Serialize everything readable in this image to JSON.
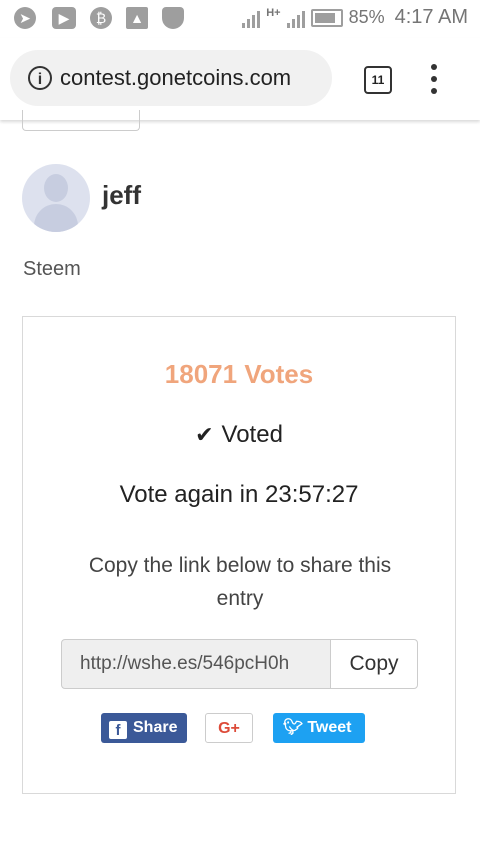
{
  "status_bar": {
    "network_label": "H+",
    "battery_percent": "85%",
    "time": "4:17 AM",
    "left_icons": [
      "telegram-icon",
      "youtube-icon",
      "bitcoin-icon",
      "image-icon",
      "shield-icon"
    ]
  },
  "browser": {
    "url": "contest.gonetcoins.com",
    "tab_count": "11"
  },
  "entry": {
    "user_name": "jeff",
    "user_sub": "Steem",
    "votes": "18071 Votes",
    "voted_label": "Voted",
    "vote_again": "Vote again in 23:57:27",
    "share_hint": "Copy the link below to share this entry",
    "share_link": "http://wshe.es/546pcH0h",
    "copy_label": "Copy",
    "facebook_label": "Share",
    "gplus_label": "G+",
    "twitter_label": "Tweet"
  },
  "colors": {
    "votes_accent": "#f0a57c",
    "facebook": "#3b5998",
    "twitter": "#1da1f2",
    "gplus": "#dd4b39"
  }
}
